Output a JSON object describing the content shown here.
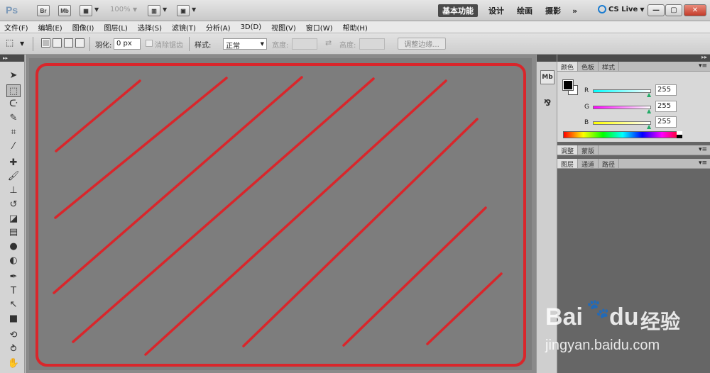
{
  "titlebar": {
    "app_logo": "Ps",
    "br_label": "Br",
    "mb_label": "Mb",
    "zoom": "100%",
    "workspaces": [
      "基本功能",
      "设计",
      "绘画",
      "摄影"
    ],
    "more": "»",
    "cslive": "CS Live",
    "minimize": "—",
    "restore": "▢",
    "close": "✕"
  },
  "menu": [
    "文件(F)",
    "编辑(E)",
    "图像(I)",
    "图层(L)",
    "选择(S)",
    "滤镜(T)",
    "分析(A)",
    "3D(D)",
    "视图(V)",
    "窗口(W)",
    "帮助(H)"
  ],
  "options": {
    "feather_label": "羽化:",
    "feather_value": "0 px",
    "antialias_label": "消除锯齿",
    "style_label": "样式:",
    "style_value": "正常",
    "width_label": "宽度:",
    "height_label": "高度:",
    "refine_label": "调整边缘..."
  },
  "panels": {
    "color_tabs": [
      "颜色",
      "色板",
      "样式"
    ],
    "channels": [
      {
        "label": "R",
        "value": "255"
      },
      {
        "label": "G",
        "value": "255"
      },
      {
        "label": "B",
        "value": "255"
      }
    ],
    "adjust_tabs": [
      "调整",
      "蒙版"
    ],
    "layer_tabs": [
      "图层",
      "通道",
      "路径"
    ],
    "menu_icon": "▾≡"
  },
  "dock": {
    "mb_label": "Mb"
  },
  "watermark": {
    "brand": "Bai",
    "brand2": "du",
    "cn": "经验",
    "url": "jingyan.baidu.com"
  },
  "colors": {
    "stroke": "#d9262b",
    "canvas": "#7d7d7d"
  }
}
